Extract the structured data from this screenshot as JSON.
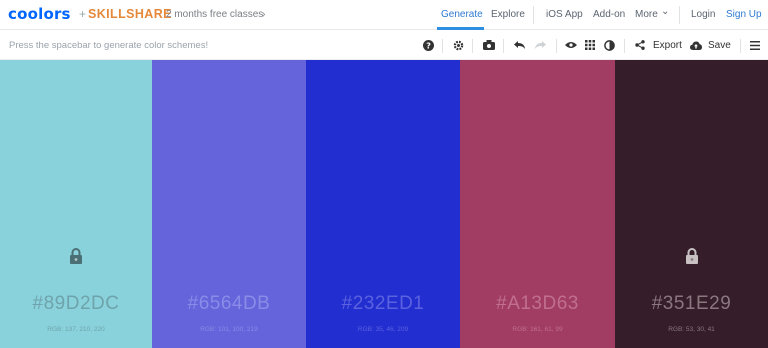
{
  "header": {
    "logo": "coolors",
    "plus": "+",
    "partner": "SKILLSHARE",
    "promo": "2 months free classes",
    "promo_arrow": "›",
    "nav": {
      "generate": "Generate",
      "explore": "Explore",
      "ios_app": "iOS App",
      "addon": "Add-on",
      "more": "More",
      "more_caret": "⌄",
      "login": "Login",
      "signup": "Sign Up"
    }
  },
  "toolbar": {
    "hint": "Press the spacebar to generate color schemes!",
    "export_label": "Export",
    "save_label": "Save",
    "icons": [
      "help-icon",
      "gear-icon",
      "camera-icon",
      "undo-icon",
      "redo-icon",
      "eye-icon",
      "grid-icon",
      "contrast-icon",
      "share-icon",
      "cloud-upload-icon",
      "menu-icon"
    ]
  },
  "palette": [
    {
      "hex": "#89D2DC",
      "rgb": "RGB: 137, 210, 220",
      "color": "#89D2DC",
      "text_color": "#6fa3ab",
      "locked": true,
      "lock_color": "#4a6f74"
    },
    {
      "hex": "#6564DB",
      "rgb": "RGB: 101, 100, 219",
      "color": "#6564DB",
      "text_color": "#8b8be8",
      "locked": false
    },
    {
      "hex": "#232ED1",
      "rgb": "RGB: 35, 46, 209",
      "color": "#232ED1",
      "text_color": "#5a62df",
      "locked": false
    },
    {
      "hex": "#A13D63",
      "rgb": "RGB: 161, 61, 99",
      "color": "#A13D63",
      "text_color": "#c06f8d",
      "locked": false
    },
    {
      "hex": "#351E29",
      "rgb": "RGB: 53, 30, 41",
      "color": "#351E29",
      "text_color": "#8a7780",
      "locked": true,
      "lock_color": "#c9c0c4"
    }
  ]
}
